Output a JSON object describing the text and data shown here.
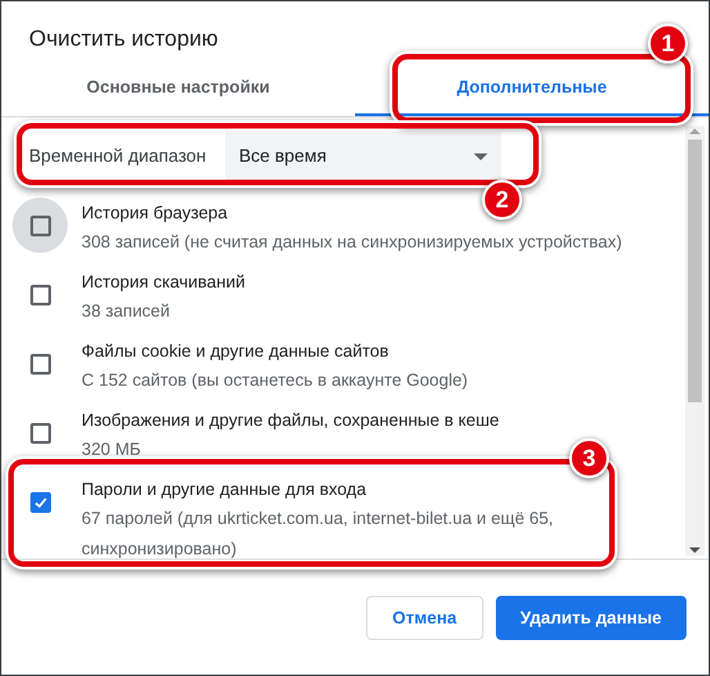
{
  "dialog": {
    "title": "Очистить историю"
  },
  "tabs": [
    {
      "label": "Основные настройки",
      "selected": false
    },
    {
      "label": "Дополнительные",
      "selected": true
    }
  ],
  "time_range": {
    "label": "Временной диапазон",
    "value": "Все время"
  },
  "items": [
    {
      "title": "История браузера",
      "detail": "308 записей (не считая данных на синхронизируемых устройствах)",
      "checked": false,
      "focused": true
    },
    {
      "title": "История скачиваний",
      "detail": "38 записей",
      "checked": false,
      "focused": false
    },
    {
      "title": "Файлы cookie и другие данные сайтов",
      "detail": "С 152 сайтов (вы останетесь в аккаунте Google)",
      "checked": false,
      "focused": false
    },
    {
      "title": "Изображения и другие файлы, сохраненные в кеше",
      "detail": "320 МБ",
      "checked": false,
      "focused": false
    },
    {
      "title": "Пароли и другие данные для входа",
      "detail": "67 паролей (для ukrticket.com.ua, internet-bilet.ua и ещё 65, синхронизировано)",
      "checked": true,
      "focused": false
    }
  ],
  "buttons": [
    {
      "label": "Отмена",
      "kind": "secondary"
    },
    {
      "label": "Удалить данные",
      "kind": "primary"
    }
  ],
  "callouts": [
    {
      "number": "1"
    },
    {
      "number": "2"
    },
    {
      "number": "3"
    }
  ]
}
